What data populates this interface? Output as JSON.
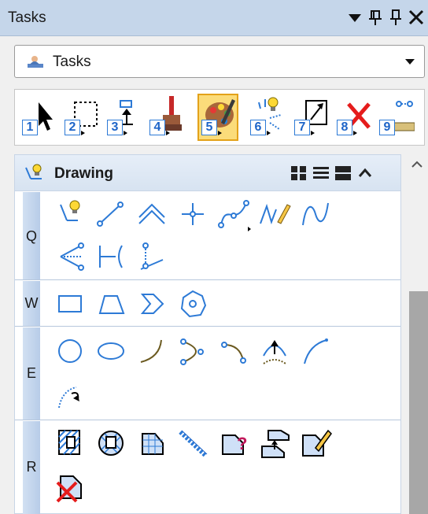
{
  "window": {
    "title": "Tasks"
  },
  "titlebar_buttons": [
    "dropdown-icon",
    "pin-icon",
    "pushpin-icon",
    "close-icon"
  ],
  "task_selector": {
    "value": "Tasks",
    "icon": "task-navigation-icon"
  },
  "toolbox": {
    "tools": [
      {
        "num": "1",
        "icon": "element-selection-icon"
      },
      {
        "num": "2",
        "icon": "fence-icon"
      },
      {
        "num": "3",
        "icon": "manipulate-icon"
      },
      {
        "num": "4",
        "icon": "modify-brush-icon"
      },
      {
        "num": "5",
        "icon": "palette-icon",
        "active": true
      },
      {
        "num": "6",
        "icon": "place-smartline-spark-icon"
      },
      {
        "num": "7",
        "icon": "scale-icon"
      },
      {
        "num": "8",
        "icon": "delete-icon"
      },
      {
        "num": "9",
        "icon": "measure-icon"
      }
    ]
  },
  "drawing_panel": {
    "title": "Drawing",
    "view_icons": [
      "icons-view-icon",
      "list-view-icon",
      "large-view-icon",
      "collapse-icon"
    ],
    "rows": [
      {
        "key": "Q",
        "icons": [
          "place-smartline-icon",
          "place-line-icon",
          "place-multiline-icon",
          "place-point-icon",
          "place-curve-icon",
          "freehand-icon",
          "place-bspline-icon",
          "construct-angle-bisector-icon",
          "construct-perpendicular-icon",
          "construct-line-at-angle-icon"
        ]
      },
      {
        "key": "W",
        "icons": [
          "place-block-icon",
          "place-shape-icon",
          "place-orthogonal-shape-icon",
          "place-regular-polygon-icon"
        ]
      },
      {
        "key": "E",
        "icons": [
          "place-circle-icon",
          "place-ellipse-icon",
          "place-arc-icon",
          "place-half-ellipse-icon",
          "place-quarter-ellipse-icon",
          "modify-arc-radius-icon",
          "modify-arc-angle-icon",
          "modify-arc-axis-icon"
        ]
      },
      {
        "key": "R",
        "icons": [
          "hatch-area-icon",
          "crosshatch-area-icon",
          "pattern-area-icon",
          "linear-pattern-icon",
          "show-pattern-attributes-icon",
          "match-pattern-attributes-icon",
          "change-pattern-icon",
          "delete-pattern-icon"
        ]
      }
    ]
  }
}
